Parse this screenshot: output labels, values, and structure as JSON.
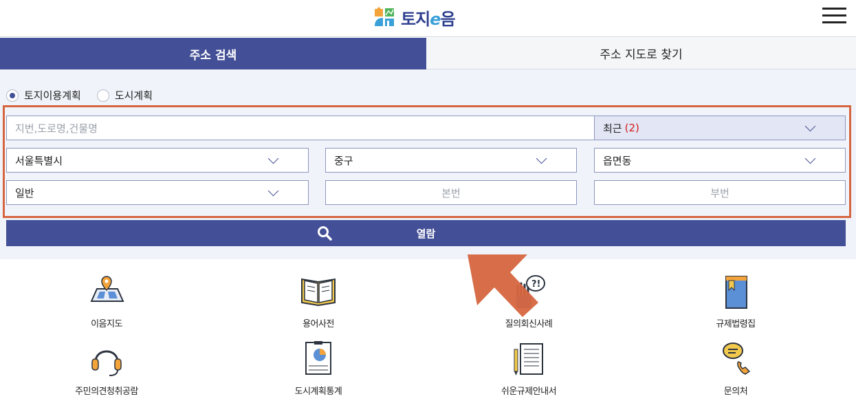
{
  "header": {
    "logo_text_1": "토지",
    "logo_text_e": "e",
    "logo_text_2": "음",
    "menu_icon": "hamburger-icon"
  },
  "tabs": [
    {
      "label": "주소 검색",
      "active": true
    },
    {
      "label": "주소 지도로 찾기",
      "active": false
    }
  ],
  "radios": [
    {
      "label": "토지이용계획",
      "checked": true
    },
    {
      "label": "도시계획",
      "checked": false
    }
  ],
  "search": {
    "address_placeholder": "지번,도로명,건물명",
    "recent_label": "최근",
    "recent_count": "(2)",
    "sido": "서울특별시",
    "sigungu": "중구",
    "dong": "읍면동",
    "land_type": "일반",
    "main_number_placeholder": "본번",
    "sub_number_placeholder": "부번",
    "view_button": "열람"
  },
  "quick_menu": [
    {
      "label": "이음지도",
      "icon": "map-pin-icon"
    },
    {
      "label": "용어사전",
      "icon": "book-icon"
    },
    {
      "label": "질의회신사례",
      "icon": "hand-question-icon"
    },
    {
      "label": "규제법령집",
      "icon": "law-book-icon"
    },
    {
      "label": "주민의견청취공람",
      "icon": "headset-icon"
    },
    {
      "label": "도시계획통계",
      "icon": "statistics-board-icon"
    },
    {
      "label": "쉬운규제안내서",
      "icon": "document-pencil-icon"
    },
    {
      "label": "문의처",
      "icon": "phone-chat-icon"
    }
  ],
  "colors": {
    "primary": "#434f96",
    "highlight_frame": "#d6653f",
    "arrow": "#d6653f",
    "count": "#d11a1a"
  }
}
